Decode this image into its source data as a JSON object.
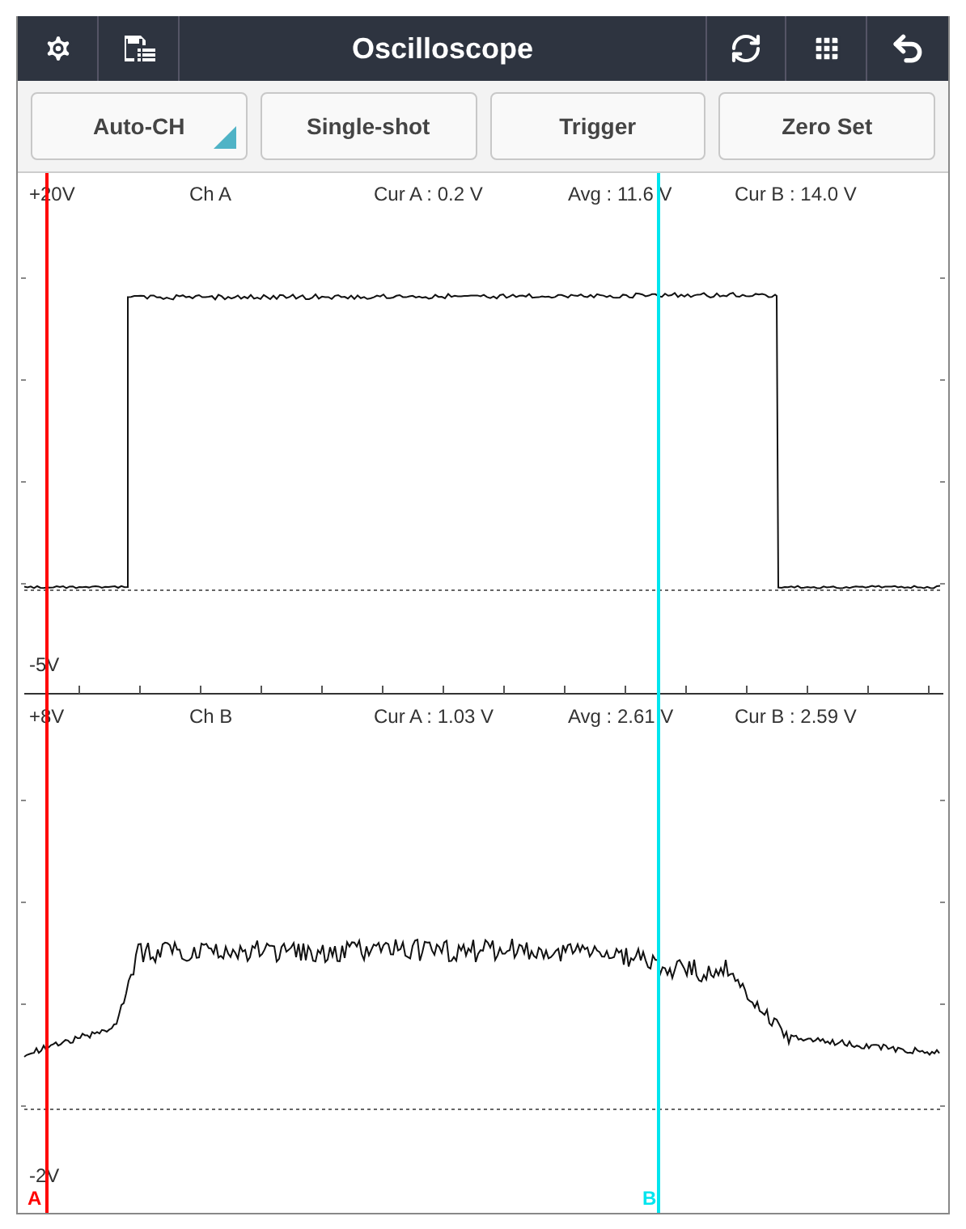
{
  "toolbar": {
    "title": "Oscilloscope"
  },
  "buttons": [
    {
      "label": "Auto-CH",
      "kind": "dropdown"
    },
    {
      "label": "Single-shot",
      "kind": "plain"
    },
    {
      "label": "Trigger",
      "kind": "plain"
    },
    {
      "label": "Zero Set",
      "kind": "plain"
    }
  ],
  "channels": [
    {
      "kind": "square",
      "range_top": "+20V",
      "range_bottom": "-5V",
      "name": "Ch A",
      "cur_a": "Cur A : 0.2 V",
      "avg": "Avg : 11.6 V",
      "cur_b": "Cur B : 14.0 V"
    },
    {
      "kind": "noisy",
      "range_top": "+8V",
      "range_bottom": "-2V",
      "name": "Ch B",
      "cur_a": "Cur A : 1.03 V",
      "avg": "Avg : 2.61 V",
      "cur_b": "Cur B : 2.59 V"
    }
  ],
  "cursors": [
    {
      "label": "A",
      "color": "#ff0000"
    },
    {
      "label": "B",
      "color": "#00e5ee"
    }
  ]
}
